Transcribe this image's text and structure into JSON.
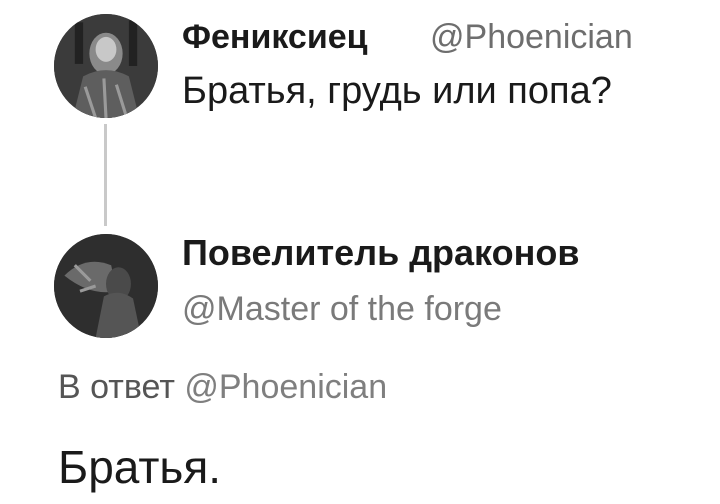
{
  "tweet": {
    "author_name": "Фениксиец",
    "author_handle": "@Phoenician",
    "text": "Братья, грудь или попа?",
    "avatar_icon": "avatar-portrait"
  },
  "reply": {
    "author_name": "Повелитель драконов",
    "author_handle": "@Master of the forge",
    "reply_prefix": "В ответ",
    "reply_to": "@Phoenician",
    "text": "Братья.",
    "avatar_icon": "avatar-portrait"
  },
  "colors": {
    "background": "#ffffff",
    "text": "#1a1a1a",
    "handle": "#6e6e6e",
    "thread_line": "#c9c9c9"
  }
}
